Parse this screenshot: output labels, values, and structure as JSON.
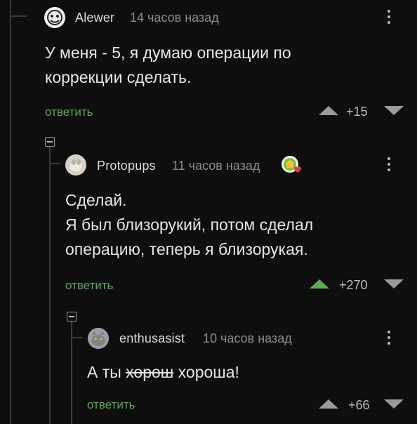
{
  "comments": [
    {
      "username": "Alewer",
      "time": "14 часов назад",
      "lines": [
        "У меня - 5, я думаю операции по",
        "коррекции сделать."
      ],
      "reply_label": "ответить",
      "score": "+15"
    },
    {
      "username": "Protopups",
      "time": "11 часов назад",
      "lines": [
        "Сделай.",
        "Я был близорукий, потом сделал",
        "операцию, теперь я близорукая."
      ],
      "reply_label": "ответить",
      "score": "+270"
    },
    {
      "username": "enthusasist",
      "time": "10 часов назад",
      "text_prefix": "А ты ",
      "text_struck": "хорош",
      "text_suffix": " хороша!",
      "reply_label": "ответить",
      "score": "+66"
    }
  ],
  "colors": {
    "accent": "#5fa85a",
    "background": "#0e0e0e",
    "muted": "#8c8c8c"
  }
}
